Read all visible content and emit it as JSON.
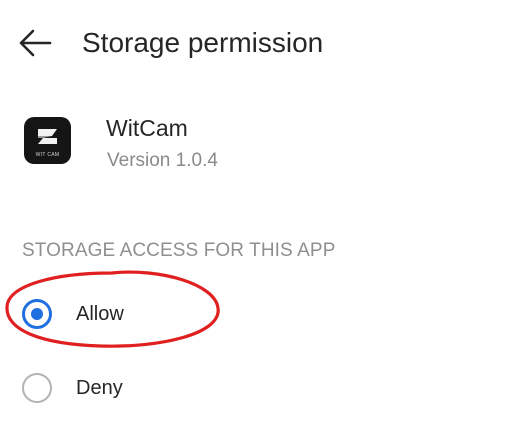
{
  "header": {
    "title": "Storage permission",
    "back_icon": "arrow-left-icon"
  },
  "app": {
    "name": "WitCam",
    "version": "Version 1.0.4",
    "icon_label": "WIT CAM",
    "icon_background": "#151515"
  },
  "section": {
    "title": "STORAGE ACCESS FOR THIS APP"
  },
  "options": [
    {
      "label": "Allow",
      "selected": true
    },
    {
      "label": "Deny",
      "selected": false
    }
  ],
  "colors": {
    "accent": "#1f6fe0",
    "highlight_annotation": "#e02020",
    "text_primary": "#262626",
    "text_secondary": "#8a8a8a"
  }
}
